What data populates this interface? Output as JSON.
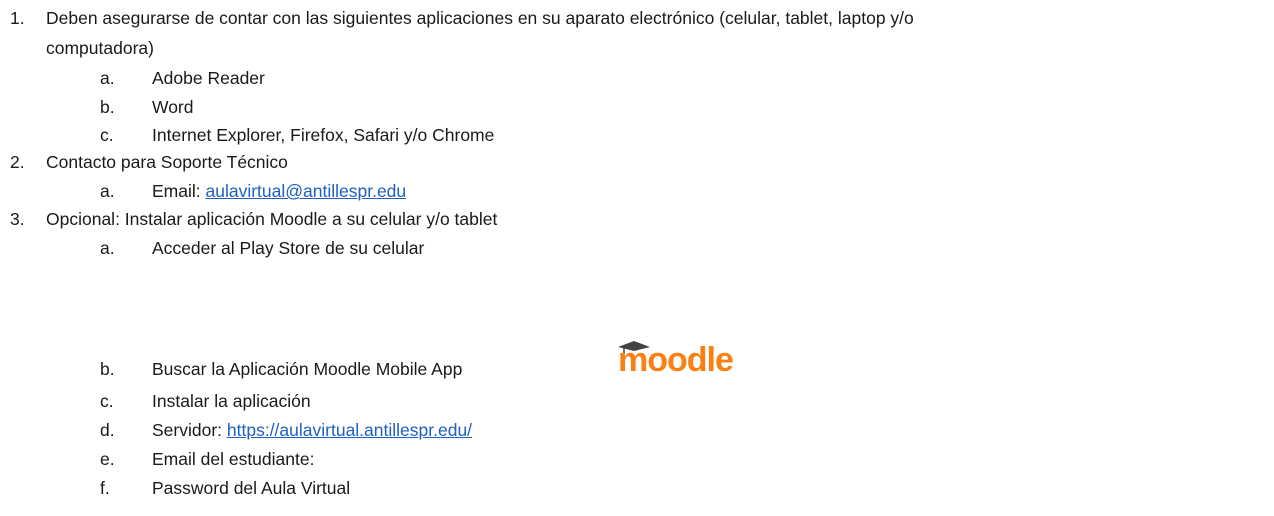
{
  "items": [
    {
      "number": "1.",
      "text_line1": "Deben asegurarse de contar con las siguientes aplicaciones en su aparato electrónico (celular, tablet, laptop y/o",
      "text_line2": "computadora)",
      "subitems": [
        {
          "letter": "a.",
          "text": "Adobe Reader"
        },
        {
          "letter": "b.",
          "text": "Word"
        },
        {
          "letter": "c.",
          "text": "Internet Explorer, Firefox, Safari y/o Chrome"
        }
      ]
    },
    {
      "number": "2.",
      "text": "Contacto para Soporte Técnico",
      "subitems": [
        {
          "letter": "a.",
          "label": "Email: ",
          "link": "aulavirtual@antillespr.edu"
        }
      ]
    },
    {
      "number": "3.",
      "text": "Opcional: Instalar aplicación Moodle a su celular y/o tablet",
      "subitems": [
        {
          "letter": "a.",
          "text": "Acceder al Play Store de su celular"
        },
        {
          "letter": "b.",
          "text": "Buscar la Aplicación Moodle Mobile App"
        },
        {
          "letter": "c.",
          "text": "Instalar la aplicación"
        },
        {
          "letter": "d.",
          "label": "Servidor: ",
          "link": "https://aulavirtual.antillespr.edu/"
        },
        {
          "letter": "e.",
          "text": "Email del estudiante:"
        },
        {
          "letter": "f.",
          "text": "Password del Aula Virtual"
        }
      ]
    }
  ],
  "logo": {
    "text": "moodle",
    "icon": "graduation-cap-icon",
    "color": "#f98012"
  },
  "colors": {
    "text": "#1a1a1a",
    "link": "#1f5fbf"
  }
}
